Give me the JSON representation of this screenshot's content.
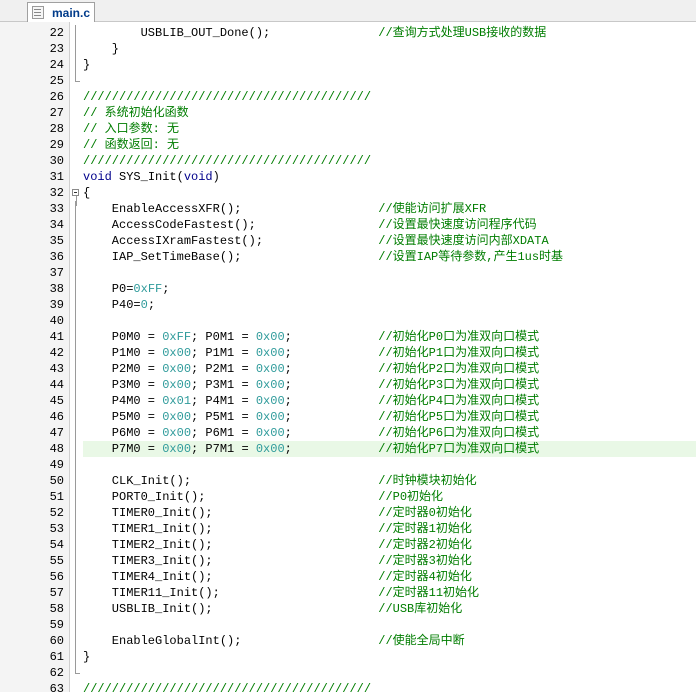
{
  "tab": {
    "label": "main.c",
    "icon": "document-icon"
  },
  "colors": {
    "comment": "#007d00",
    "keyword": "#00008b",
    "number": "#2f9b9b",
    "highlight": "#e9f8e6"
  },
  "highlighted_line": 48,
  "lines": [
    {
      "n": "22",
      "fold": "line",
      "segs": [
        [
          "t",
          "        USBLIB_OUT_Done();               "
        ],
        [
          "c",
          "//查询方式处理USB接收的数据"
        ]
      ]
    },
    {
      "n": "23",
      "fold": "line",
      "segs": [
        [
          "t",
          "    }"
        ]
      ]
    },
    {
      "n": "24",
      "fold": "line",
      "segs": [
        [
          "t",
          "}"
        ]
      ]
    },
    {
      "n": "25",
      "fold": "end",
      "segs": []
    },
    {
      "n": "26",
      "fold": "",
      "segs": [
        [
          "c",
          "////////////////////////////////////////"
        ]
      ]
    },
    {
      "n": "27",
      "fold": "",
      "segs": [
        [
          "c",
          "// 系统初始化函数"
        ]
      ]
    },
    {
      "n": "28",
      "fold": "",
      "segs": [
        [
          "c",
          "// 入口参数: 无"
        ]
      ]
    },
    {
      "n": "29",
      "fold": "",
      "segs": [
        [
          "c",
          "// 函数返回: 无"
        ]
      ]
    },
    {
      "n": "30",
      "fold": "",
      "segs": [
        [
          "c",
          "////////////////////////////////////////"
        ]
      ]
    },
    {
      "n": "31",
      "fold": "",
      "segs": [
        [
          "k",
          "void"
        ],
        [
          "t",
          " SYS_Init("
        ],
        [
          "k",
          "void"
        ],
        [
          "t",
          ")"
        ]
      ]
    },
    {
      "n": "32",
      "fold": "box",
      "segs": [
        [
          "t",
          "{"
        ]
      ]
    },
    {
      "n": "33",
      "fold": "line",
      "segs": [
        [
          "t",
          "    EnableAccessXFR();                   "
        ],
        [
          "c",
          "//使能访问扩展XFR"
        ]
      ]
    },
    {
      "n": "34",
      "fold": "line",
      "segs": [
        [
          "t",
          "    AccessCodeFastest();                 "
        ],
        [
          "c",
          "//设置最快速度访问程序代码"
        ]
      ]
    },
    {
      "n": "35",
      "fold": "line",
      "segs": [
        [
          "t",
          "    AccessIXramFastest();                "
        ],
        [
          "c",
          "//设置最快速度访问内部XDATA"
        ]
      ]
    },
    {
      "n": "36",
      "fold": "line",
      "segs": [
        [
          "t",
          "    IAP_SetTimeBase();                   "
        ],
        [
          "c",
          "//设置IAP等待参数,产生1us时基"
        ]
      ]
    },
    {
      "n": "37",
      "fold": "line",
      "segs": []
    },
    {
      "n": "38",
      "fold": "line",
      "segs": [
        [
          "t",
          "    P0="
        ],
        [
          "h",
          "0xFF"
        ],
        [
          "t",
          ";"
        ]
      ]
    },
    {
      "n": "39",
      "fold": "line",
      "segs": [
        [
          "t",
          "    P40="
        ],
        [
          "h",
          "0"
        ],
        [
          "t",
          ";"
        ]
      ]
    },
    {
      "n": "40",
      "fold": "line",
      "segs": []
    },
    {
      "n": "41",
      "fold": "line",
      "segs": [
        [
          "t",
          "    P0M0 = "
        ],
        [
          "h",
          "0xFF"
        ],
        [
          "t",
          "; P0M1 = "
        ],
        [
          "h",
          "0x00"
        ],
        [
          "t",
          ";            "
        ],
        [
          "c",
          "//初始化P0口为准双向口模式"
        ]
      ]
    },
    {
      "n": "42",
      "fold": "line",
      "segs": [
        [
          "t",
          "    P1M0 = "
        ],
        [
          "h",
          "0x00"
        ],
        [
          "t",
          "; P1M1 = "
        ],
        [
          "h",
          "0x00"
        ],
        [
          "t",
          ";            "
        ],
        [
          "c",
          "//初始化P1口为准双向口模式"
        ]
      ]
    },
    {
      "n": "43",
      "fold": "line",
      "segs": [
        [
          "t",
          "    P2M0 = "
        ],
        [
          "h",
          "0x00"
        ],
        [
          "t",
          "; P2M1 = "
        ],
        [
          "h",
          "0x00"
        ],
        [
          "t",
          ";            "
        ],
        [
          "c",
          "//初始化P2口为准双向口模式"
        ]
      ]
    },
    {
      "n": "44",
      "fold": "line",
      "segs": [
        [
          "t",
          "    P3M0 = "
        ],
        [
          "h",
          "0x00"
        ],
        [
          "t",
          "; P3M1 = "
        ],
        [
          "h",
          "0x00"
        ],
        [
          "t",
          ";            "
        ],
        [
          "c",
          "//初始化P3口为准双向口模式"
        ]
      ]
    },
    {
      "n": "45",
      "fold": "line",
      "segs": [
        [
          "t",
          "    P4M0 = "
        ],
        [
          "h",
          "0x01"
        ],
        [
          "t",
          "; P4M1 = "
        ],
        [
          "h",
          "0x00"
        ],
        [
          "t",
          ";            "
        ],
        [
          "c",
          "//初始化P4口为准双向口模式"
        ]
      ]
    },
    {
      "n": "46",
      "fold": "line",
      "segs": [
        [
          "t",
          "    P5M0 = "
        ],
        [
          "h",
          "0x00"
        ],
        [
          "t",
          "; P5M1 = "
        ],
        [
          "h",
          "0x00"
        ],
        [
          "t",
          ";            "
        ],
        [
          "c",
          "//初始化P5口为准双向口模式"
        ]
      ]
    },
    {
      "n": "47",
      "fold": "line",
      "segs": [
        [
          "t",
          "    P6M0 = "
        ],
        [
          "h",
          "0x00"
        ],
        [
          "t",
          "; P6M1 = "
        ],
        [
          "h",
          "0x00"
        ],
        [
          "t",
          ";            "
        ],
        [
          "c",
          "//初始化P6口为准双向口模式"
        ]
      ]
    },
    {
      "n": "48",
      "fold": "line",
      "segs": [
        [
          "t",
          "    P7M0 = "
        ],
        [
          "h",
          "0x00"
        ],
        [
          "t",
          "; P7M1 = "
        ],
        [
          "h",
          "0x00"
        ],
        [
          "t",
          ";            "
        ],
        [
          "c",
          "//初始化P7口为准双向口模式"
        ]
      ]
    },
    {
      "n": "49",
      "fold": "line",
      "segs": []
    },
    {
      "n": "50",
      "fold": "line",
      "segs": [
        [
          "t",
          "    CLK_Init();                          "
        ],
        [
          "c",
          "//时钟模块初始化"
        ]
      ]
    },
    {
      "n": "51",
      "fold": "line",
      "segs": [
        [
          "t",
          "    PORT0_Init();                        "
        ],
        [
          "c",
          "//P0初始化"
        ]
      ]
    },
    {
      "n": "52",
      "fold": "line",
      "segs": [
        [
          "t",
          "    TIMER0_Init();                       "
        ],
        [
          "c",
          "//定时器0初始化"
        ]
      ]
    },
    {
      "n": "53",
      "fold": "line",
      "segs": [
        [
          "t",
          "    TIMER1_Init();                       "
        ],
        [
          "c",
          "//定时器1初始化"
        ]
      ]
    },
    {
      "n": "54",
      "fold": "line",
      "segs": [
        [
          "t",
          "    TIMER2_Init();                       "
        ],
        [
          "c",
          "//定时器2初始化"
        ]
      ]
    },
    {
      "n": "55",
      "fold": "line",
      "segs": [
        [
          "t",
          "    TIMER3_Init();                       "
        ],
        [
          "c",
          "//定时器3初始化"
        ]
      ]
    },
    {
      "n": "56",
      "fold": "line",
      "segs": [
        [
          "t",
          "    TIMER4_Init();                       "
        ],
        [
          "c",
          "//定时器4初始化"
        ]
      ]
    },
    {
      "n": "57",
      "fold": "line",
      "segs": [
        [
          "t",
          "    TIMER11_Init();                      "
        ],
        [
          "c",
          "//定时器11初始化"
        ]
      ]
    },
    {
      "n": "58",
      "fold": "line",
      "segs": [
        [
          "t",
          "    USBLIB_Init();                       "
        ],
        [
          "c",
          "//USB库初始化"
        ]
      ]
    },
    {
      "n": "59",
      "fold": "line",
      "segs": []
    },
    {
      "n": "60",
      "fold": "line",
      "segs": [
        [
          "t",
          "    EnableGlobalInt();                   "
        ],
        [
          "c",
          "//使能全局中断"
        ]
      ]
    },
    {
      "n": "61",
      "fold": "line",
      "segs": [
        [
          "t",
          "}"
        ]
      ]
    },
    {
      "n": "62",
      "fold": "end",
      "segs": []
    },
    {
      "n": "63",
      "fold": "",
      "segs": [
        [
          "c",
          "////////////////////////////////////////"
        ]
      ]
    }
  ]
}
